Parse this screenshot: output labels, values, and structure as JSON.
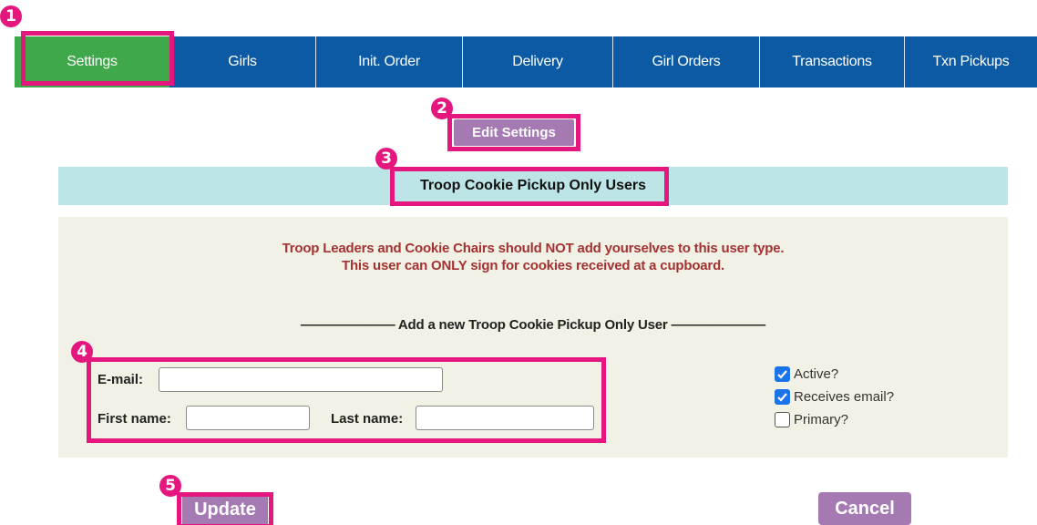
{
  "nav": {
    "items": [
      {
        "label": "Settings",
        "active": true
      },
      {
        "label": "Girls"
      },
      {
        "label": "Init. Order"
      },
      {
        "label": "Delivery"
      },
      {
        "label": "Girl Orders"
      },
      {
        "label": "Transactions"
      },
      {
        "label": "Txn Pickups"
      }
    ]
  },
  "callouts": [
    "1",
    "2",
    "3",
    "4",
    "5"
  ],
  "edit_settings_label": "Edit Settings",
  "section_title": "Troop Cookie Pickup Only Users",
  "warning": {
    "line1": "Troop Leaders and Cookie Chairs should NOT add yourselves to this user type.",
    "line2": "This user can ONLY sign for cookies received at a cupboard."
  },
  "add_user_title": "——————— Add a new Troop Cookie Pickup Only User ———————",
  "form": {
    "email_label": "E-mail:",
    "email_value": "",
    "first_name_label": "First name:",
    "first_name_value": "",
    "last_name_label": "Last name:",
    "last_name_value": ""
  },
  "checkboxes": {
    "active": {
      "label": "Active?",
      "checked": true
    },
    "receives_email": {
      "label": "Receives email?",
      "checked": true
    },
    "primary": {
      "label": "Primary?",
      "checked": false
    }
  },
  "buttons": {
    "update": "Update",
    "cancel": "Cancel"
  },
  "colors": {
    "nav_bg": "#0b5aa3",
    "nav_active": "#3ea84a",
    "callout": "#e5177e",
    "button": "#a57ab3",
    "header_bg": "#bde4e7",
    "panel_bg": "#f2f1e6",
    "warning_text": "#a33232"
  }
}
